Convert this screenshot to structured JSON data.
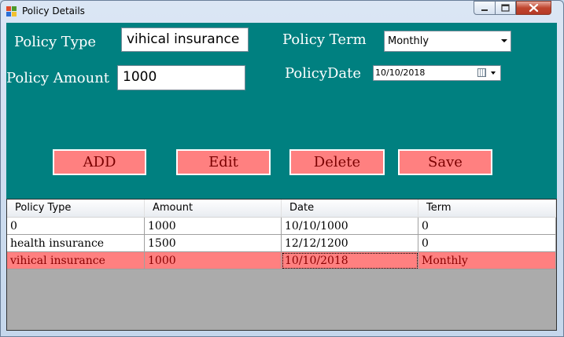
{
  "window": {
    "title": "Policy Details"
  },
  "form": {
    "policy_type_label": "Policy Type",
    "policy_type_value": "vihical insurance",
    "policy_amount_label": "Policy Amount",
    "policy_amount_value": "1000",
    "policy_term_label": "Policy Term",
    "policy_term_value": "Monthly",
    "policy_date_label": "PolicyDate",
    "policy_date_value": "10/10/2018"
  },
  "buttons": {
    "add": "ADD",
    "edit": "Edit",
    "delete": "Delete",
    "save": "Save"
  },
  "grid": {
    "columns": [
      "Policy Type",
      "Amount",
      "Date",
      "Term"
    ],
    "rows": [
      [
        "0",
        "1000",
        "10/10/1000",
        "0"
      ],
      [
        "health insurance",
        "1500",
        "12/12/1200",
        "0"
      ],
      [
        "vihical insurance",
        "1000",
        "10/10/2018",
        "Monthly"
      ]
    ],
    "selected_row": 2
  },
  "colors": {
    "client_background": "#008080",
    "button_background": "#ff8080",
    "selected_row": "#ff8080",
    "grid_empty": "#ababab"
  }
}
